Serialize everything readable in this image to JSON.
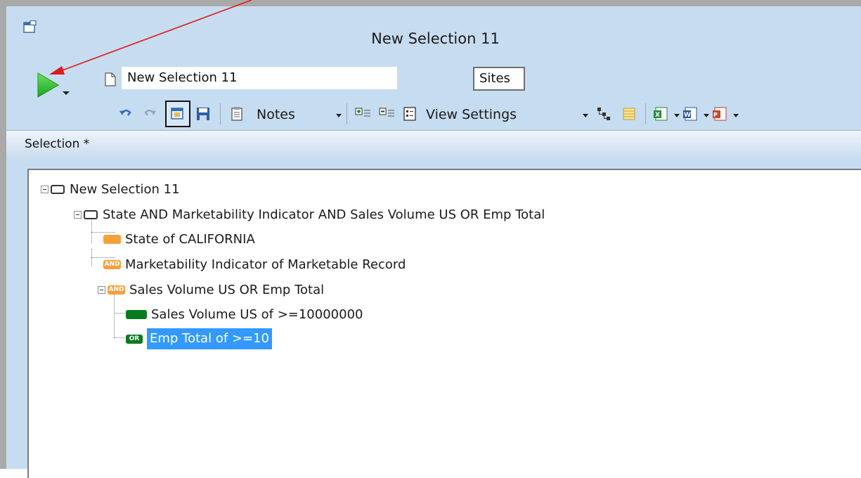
{
  "window": {
    "title": "New Selection 11"
  },
  "toolbar": {
    "selection_name": "New Selection 11",
    "sites_label": "Sites",
    "notes_label": "Notes",
    "view_settings_label": "View Settings"
  },
  "section": {
    "label": "Selection *"
  },
  "tree": {
    "root": "New Selection 11",
    "group": "State AND Marketability Indicator AND Sales Volume US OR Emp Total",
    "item_state": "State of CALIFORNIA",
    "item_market": "Marketability Indicator of Marketable Record",
    "subgroup": "Sales Volume US OR Emp Total",
    "item_sales": "Sales Volume US of >=10000000",
    "item_emp": "Emp Total of >=10",
    "badge_and": "AND",
    "badge_or": "OR"
  },
  "colors": {
    "accent_orange": "#f6a03c",
    "accent_green": "#0a7a1e",
    "selection_blue": "#3399ff",
    "arrow_red": "#e0191d"
  },
  "icons": [
    "window-icon",
    "run-icon",
    "document-icon",
    "undo-icon",
    "redo-icon",
    "properties-icon",
    "save-icon",
    "notes-icon",
    "add-criteria-icon",
    "remove-criteria-icon",
    "criteria-list-icon",
    "view-settings-icon",
    "tree-view-icon",
    "grid-view-icon",
    "export-excel-icon",
    "export-word-icon",
    "export-pdf-icon"
  ]
}
